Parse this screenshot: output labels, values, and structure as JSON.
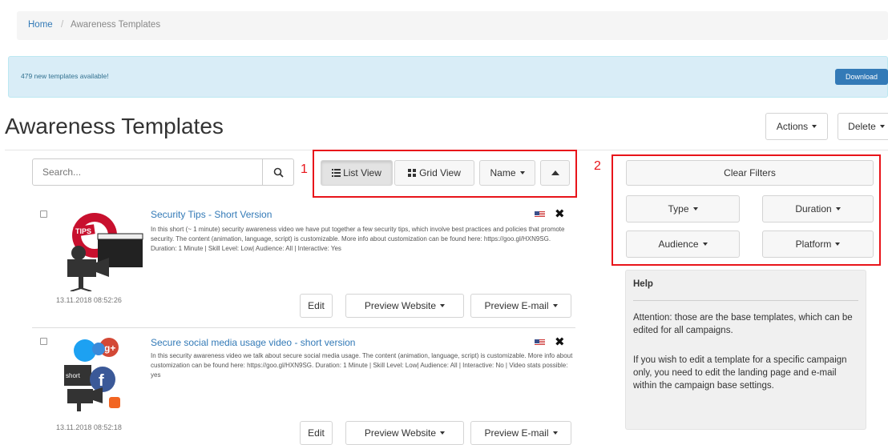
{
  "breadcrumb": {
    "home": "Home",
    "separator": "/",
    "current": "Awareness Templates"
  },
  "notice": {
    "text": "479 new templates available!",
    "download_label": "Download"
  },
  "header": {
    "title": "Awareness Templates",
    "actions_label": "Actions",
    "delete_label": "Delete"
  },
  "search": {
    "placeholder": "Search..."
  },
  "view_controls": {
    "list_view": "List View",
    "grid_view": "Grid View",
    "sort_label": "Name"
  },
  "annotations": {
    "one": "1",
    "two": "2"
  },
  "filters": {
    "clear_label": "Clear Filters",
    "type_label": "Type",
    "duration_label": "Duration",
    "audience_label": "Audience",
    "platform_label": "Platform"
  },
  "templates": [
    {
      "title": "Security Tips - Short Version",
      "description": "In this short (~ 1 minute) security awareness video we have put together a few security tips, which involve best practices and policies that promote security. The content (animation, language, script) is customizable. More info about customization can be found here: https://goo.gl/HXN9SG. Duration: 1 Minute | Skill Level: Low| Audience: All | Interactive: Yes",
      "date": "13.11.2018 08:52:26",
      "edit_label": "Edit",
      "preview_website_label": "Preview Website",
      "preview_email_label": "Preview E-mail"
    },
    {
      "title": "Secure social media usage video - short version",
      "description": "In this security awareness video we talk about secure social media usage. The content (animation, language, script) is customizable. More info about customization can be found here: https://goo.gl/HXN9SG. Duration: 1 Minute | Skill Level: Low| Audience: All | Interactive: No | Video stats possible: yes",
      "date": "13.11.2018 08:52:18",
      "edit_label": "Edit",
      "preview_website_label": "Preview Website",
      "preview_email_label": "Preview E-mail"
    }
  ],
  "help": {
    "title": "Help",
    "paragraph1": "Attention: those are the base templates, which can be edited for all campaigns.",
    "paragraph2": "If you wish to edit a template for a specific campaign only, you need to edit the landing page and e-mail within the campaign base settings."
  },
  "colors": {
    "link": "#337ab7",
    "info_bg": "#d9edf7",
    "download_btn": "#337ab7",
    "annotation_red": "#e8141a",
    "help_bg": "#f0f0f0"
  }
}
